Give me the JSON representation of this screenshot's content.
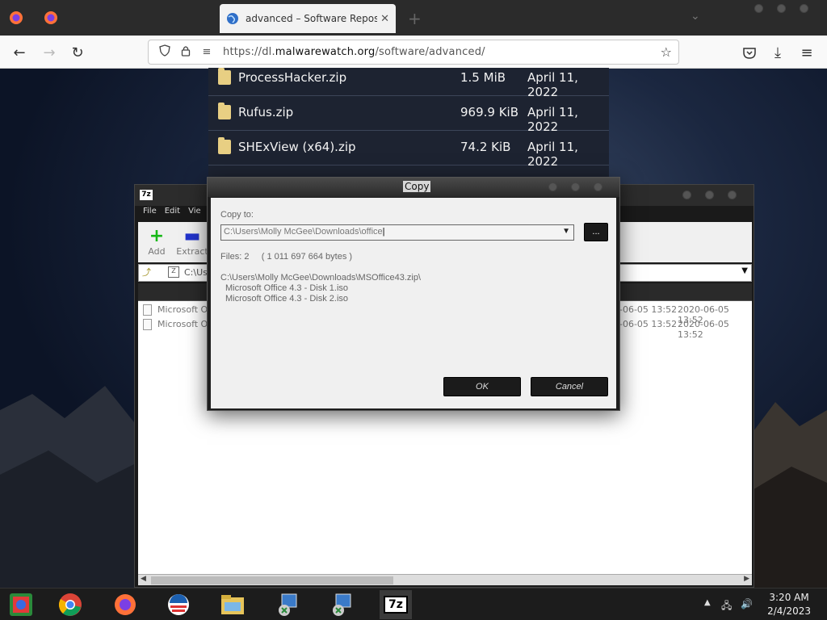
{
  "browser": {
    "tab_title": "advanced – Software Repository",
    "tab_close": "✕",
    "new_tab": "+",
    "url_prefix": "https://dl.",
    "url_domain": "malwarewatch.org",
    "url_path": "/software/advanced/"
  },
  "listing": {
    "rows": [
      {
        "name": "ProcessHacker.zip",
        "size": "1.5 MiB",
        "date": "April 11, 2022"
      },
      {
        "name": "Rufus.zip",
        "size": "969.9 KiB",
        "date": "April 11, 2022"
      },
      {
        "name": "SHExView (x64).zip",
        "size": "74.2 KiB",
        "date": "April 11, 2022"
      }
    ]
  },
  "sevenzip": {
    "logo": "7z",
    "menu": [
      "File",
      "Edit",
      "Vie"
    ],
    "toolbar": {
      "add": "Add",
      "extract": "Extract"
    },
    "address": "C:\\Us",
    "rows": [
      {
        "name": "Microsoft O",
        "modified": "-06-05 13:52",
        "created": "2020-06-05 13:52"
      },
      {
        "name": "Microsoft O",
        "modified": "-06-05 13:52",
        "created": "2020-06-05 13:52"
      }
    ]
  },
  "dialog": {
    "title": "Copy",
    "copy_to_label": "Copy to:",
    "path_value": "C:\\Users\\Molly McGee\\Downloads\\office",
    "browse_label": "...",
    "files_info": "Files: 2     ( 1 011 697 664 bytes )",
    "source_path": "C:\\Users\\Molly McGee\\Downloads\\MSOffice43.zip\\",
    "items": [
      "Microsoft Office 4.3 - Disk 1.iso",
      "Microsoft Office 4.3 - Disk 2.iso"
    ],
    "ok_label": "OK",
    "cancel_label": "Cancel"
  },
  "taskbar": {
    "sevenzip_label": "7z",
    "time": "3:20 AM",
    "date": "2/4/2023"
  }
}
